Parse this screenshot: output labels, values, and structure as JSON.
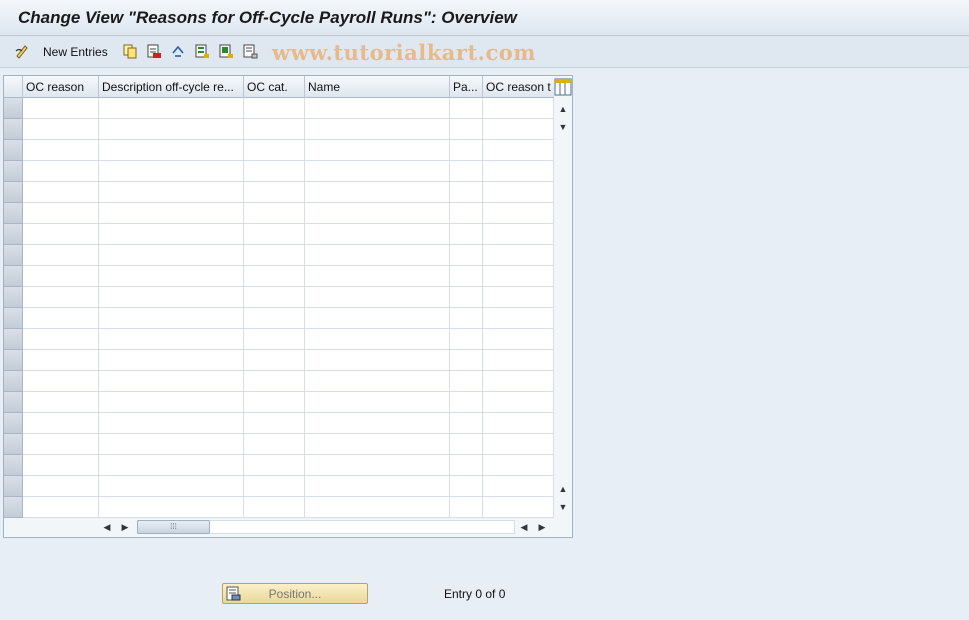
{
  "window": {
    "title": "Change View \"Reasons for Off-Cycle Payroll Runs\": Overview"
  },
  "toolbar": {
    "new_entries_label": "New Entries",
    "watermark": "www.tutorialkart.com",
    "icons": [
      "pencil-glasses-icon",
      "copy-icon",
      "delete-icon",
      "undo-icon",
      "select-all-icon",
      "select-block-icon",
      "deselect-all-icon"
    ]
  },
  "table": {
    "columns": [
      "OC reason",
      "Description off-cycle re...",
      "OC cat.",
      "Name",
      "Pa...",
      "OC reason t"
    ],
    "rows": [],
    "empty_row_count": 20
  },
  "footer": {
    "position_button_label": "Position...",
    "entry_status": "Entry 0 of 0"
  }
}
